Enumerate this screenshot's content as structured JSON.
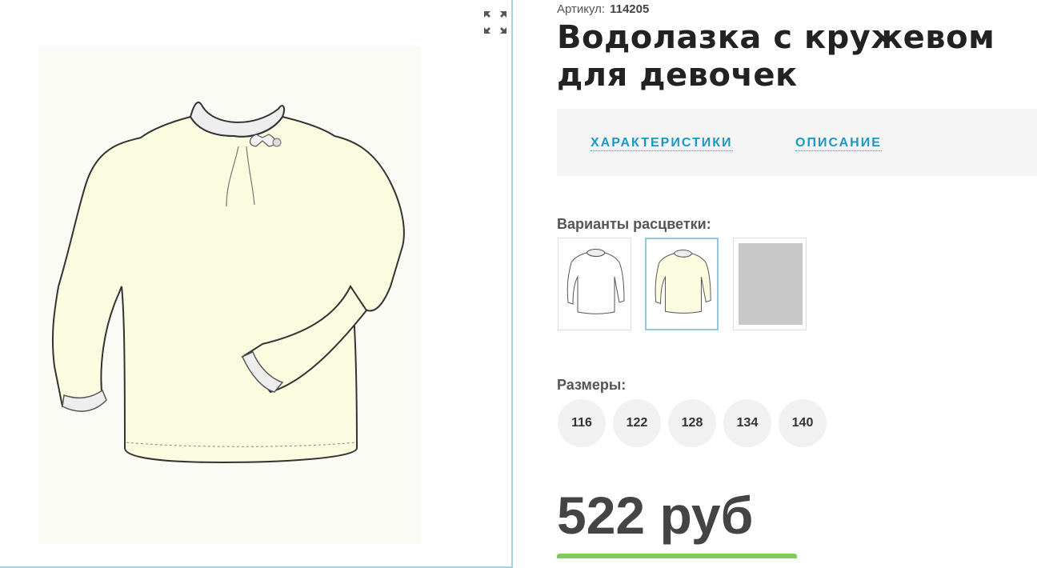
{
  "product": {
    "sku_label": "Артикул:",
    "sku_value": "114205",
    "title": "Водолазка с кружевом для девочек",
    "price": "522 руб"
  },
  "tabs": [
    {
      "label": "ХАРАКТЕРИСТИКИ"
    },
    {
      "label": "ОПИСАНИЕ"
    }
  ],
  "colors": {
    "label": "Варианты расцветки:",
    "options": [
      {
        "name": "white",
        "hex": "#ffffff"
      },
      {
        "name": "cream",
        "hex": "#fbfbe0",
        "selected": true
      },
      {
        "name": "grey",
        "hex": "#c8c8c8"
      }
    ]
  },
  "sizes": {
    "label": "Размеры:",
    "options": [
      "116",
      "122",
      "128",
      "134",
      "140"
    ]
  },
  "theme": {
    "accent": "#1a97c9",
    "border_accent": "#a3d4e6",
    "garment_fill": "#fbfbe0",
    "buy_button": "#7fcb5a"
  }
}
